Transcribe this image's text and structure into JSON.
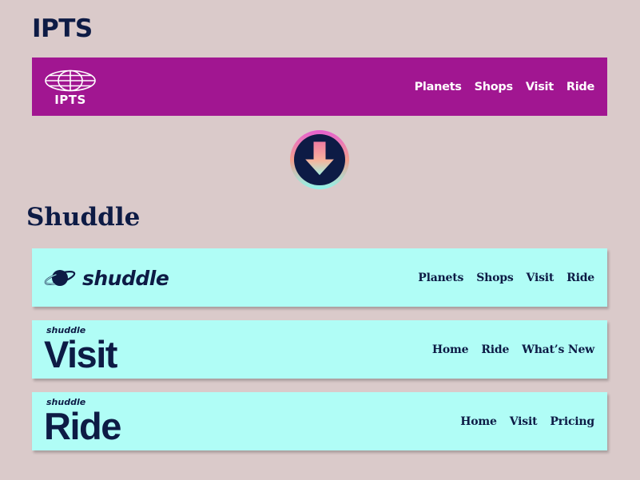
{
  "ipts": {
    "heading": "IPTS",
    "logo_text": "IPTS",
    "nav": [
      "Planets",
      "Shops",
      "Visit",
      "Ride"
    ]
  },
  "shuddle": {
    "heading": "Shuddle",
    "main": {
      "wordmark": "shuddle",
      "nav": [
        "Planets",
        "Shops",
        "Visit",
        "Ride"
      ]
    },
    "visit": {
      "small": "shuddle",
      "big": "Visit",
      "nav": [
        "Home",
        "Ride",
        "What’s New"
      ]
    },
    "ride": {
      "small": "shuddle",
      "big": "Ride",
      "nav": [
        "Home",
        "Visit",
        "Pricing"
      ]
    }
  },
  "colors": {
    "background": "#dacaca",
    "ipts_bar": "#a11691",
    "shuddle_bar": "#b0fdf6",
    "navy": "#0d1b45"
  },
  "icons": {
    "globe": "globe-icon",
    "arrow": "down-arrow-icon",
    "planet": "planet-icon"
  }
}
